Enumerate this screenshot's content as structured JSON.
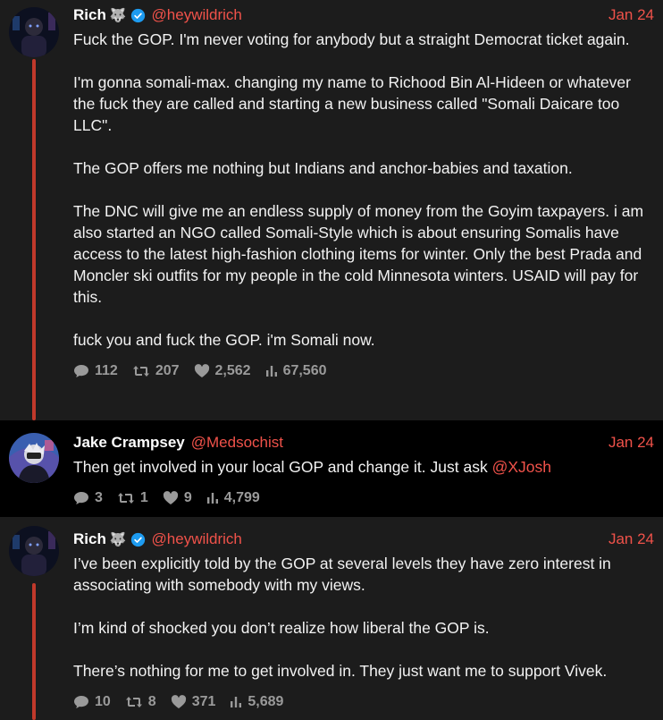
{
  "tweets": [
    {
      "name": "Rich",
      "name_emoji": "🐺",
      "handle": "@heywildrich",
      "date": "Jan 24",
      "paragraphs": [
        "Fuck the GOP. I'm never voting for anybody but a straight Democrat ticket again.",
        "I'm gonna somali-max. changing my name to Richood Bin Al-Hideen or whatever the fuck they are called and starting a new business called \"Somali Daicare too LLC\".",
        "The GOP offers me nothing but Indians and anchor-babies and taxation.",
        "The DNC will give me an endless supply of money from the Goyim taxpayers. i am also started an NGO called Somali-Style which is about ensuring Somalis have access to the latest high-fashion clothing items for winter. Only the  best Prada and Moncler ski outfits for my people in the cold Minnesota winters. USAID will pay for this.",
        "fuck you and fuck the GOP. i'm Somali now."
      ],
      "stats": {
        "replies": "112",
        "retweets": "207",
        "likes": "2,562",
        "views": "67,560"
      }
    },
    {
      "name": "Jake Crampsey",
      "handle": "@Medsochist",
      "date": "Jan 24",
      "text": "Then get involved in your local GOP and change it. Just ask ",
      "mention": "@XJosh",
      "stats": {
        "replies": "3",
        "retweets": "1",
        "likes": "9",
        "views": "4,799"
      }
    },
    {
      "name": "Rich",
      "name_emoji": "🐺",
      "handle": "@heywildrich",
      "date": "Jan 24",
      "paragraphs": [
        "I’ve been explicitly told by the GOP at several levels they have zero interest in associating with somebody with my views.",
        "I’m kind of shocked you don’t realize how liberal the GOP is.",
        "There’s nothing for me to get involved in. They just want me to support Vivek."
      ],
      "stats": {
        "replies": "10",
        "retweets": "8",
        "likes": "371",
        "views": "5,689"
      }
    }
  ],
  "colors": {
    "accent": "#f0524a",
    "thread_line": "#c0392b",
    "verified": "#1d9bf0",
    "stat_gray": "#9a9a9a"
  },
  "icons": {
    "reply": "reply-icon",
    "retweet": "retweet-icon",
    "like": "heart-icon",
    "views": "views-icon",
    "verified": "verified-badge-icon"
  }
}
